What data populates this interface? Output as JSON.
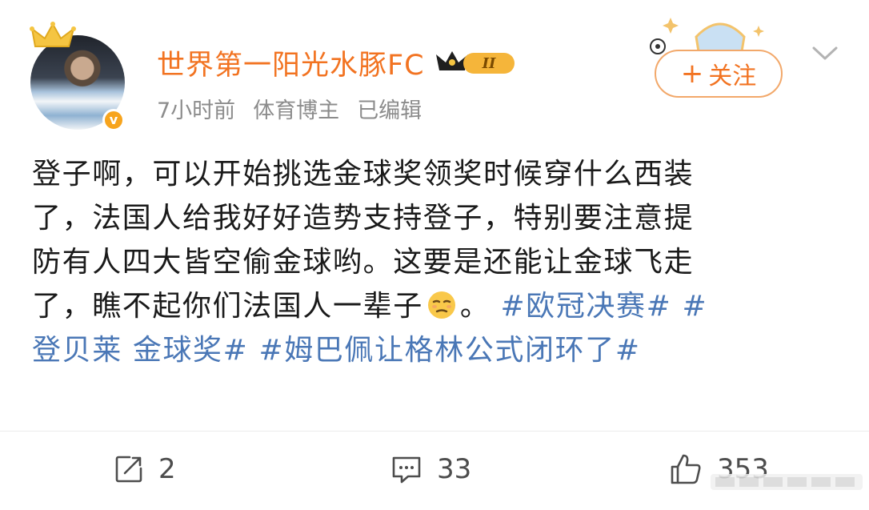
{
  "user": {
    "name": "世界第一阳光水豚FC",
    "level_badge": "II",
    "verified_symbol": "v"
  },
  "meta": {
    "time": "7小时前",
    "role": "体育博主",
    "edited": "已编辑"
  },
  "follow": {
    "plus": "+",
    "label": "关注"
  },
  "post": {
    "line1": "登子啊，可以开始挑选金球奖领奖时候穿什么西装",
    "line2": "了，法国人给我好好造势支持登子，特别要注意提",
    "line3": "防有人四大皆空偷金球哟。这要是还能让金球飞走",
    "line4_text": "了，瞧不起你们法国人一辈子",
    "line4_after_emoji": "。",
    "hashtag1": "#欧冠决赛#",
    "hashtag2_part1": "#",
    "hashtag2_part2": "登贝莱 金球奖#",
    "hashtag3": "#姆巴佩让格林公式闭环了#",
    "emoji": "unamused-face"
  },
  "actions": {
    "repost_count": "2",
    "comment_count": "33",
    "like_count": "353"
  },
  "colors": {
    "name": "#f27321",
    "hashtag": "#4a77b6",
    "meta": "#8c8c8c",
    "follow_border": "#f2a86a"
  }
}
